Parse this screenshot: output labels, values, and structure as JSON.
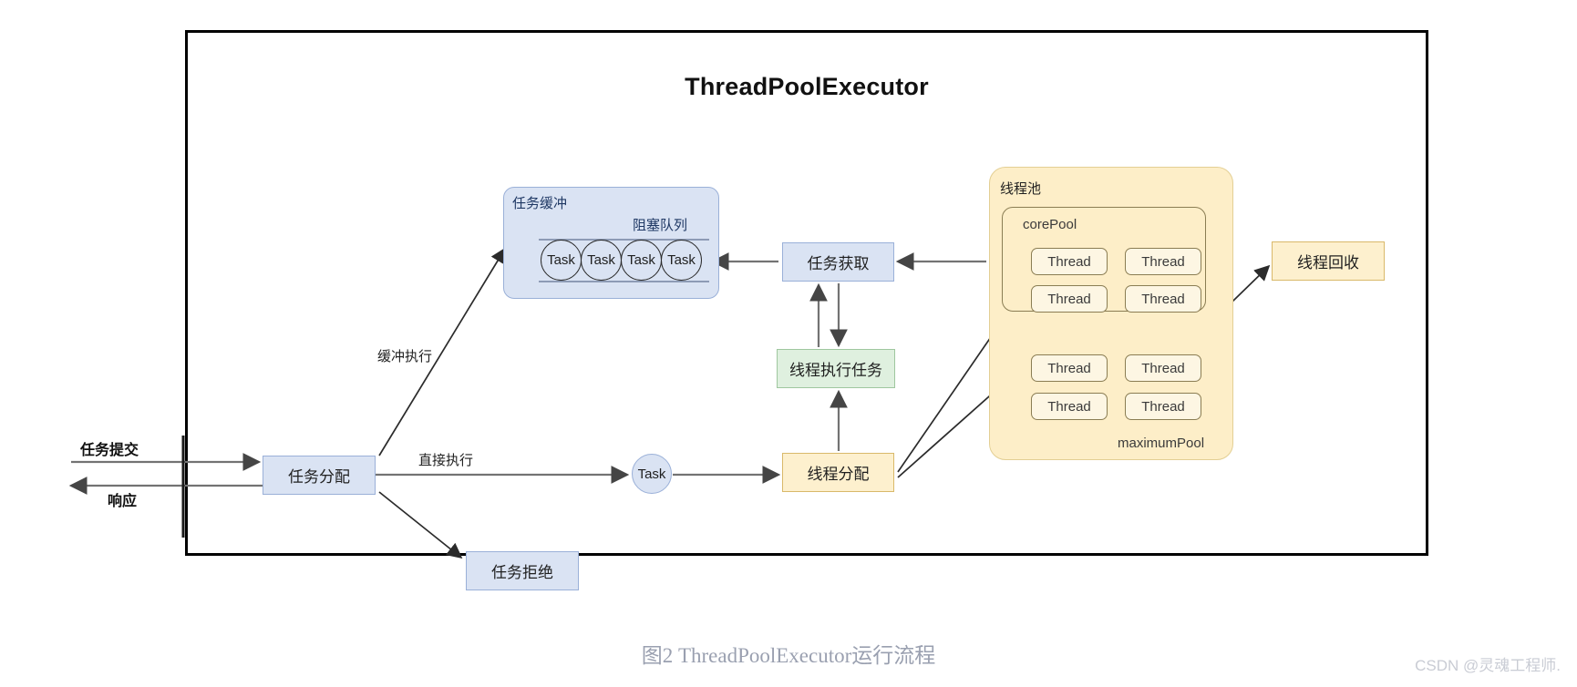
{
  "diagram": {
    "title": "ThreadPoolExecutor",
    "caption": "图2 ThreadPoolExecutor运行流程",
    "watermark": "CSDN @灵魂工程师."
  },
  "colors": {
    "blue_fill": "#dae3f3",
    "blue_stroke": "#9ab0d8",
    "green_fill": "#dff0df",
    "green_stroke": "#9fc79f",
    "orange_fill": "#fdf0ce",
    "orange_stroke": "#d9b96a",
    "pool_fill": "#fdeec8",
    "pool_stroke": "#e3cf94",
    "frame_stroke": "#000000",
    "arrow_stroke": "#737373",
    "thin_arrow_stroke": "#2b2b2b",
    "caption_text": "#9aa0b0",
    "watermark_text": "#c9ccd4"
  },
  "task_buffer": {
    "label": "任务缓冲",
    "queue_label": "阻塞队列",
    "tasks": [
      "Task",
      "Task",
      "Task",
      "Task"
    ]
  },
  "nodes": {
    "task_fetch": "任务获取",
    "thread_exec": "线程执行任务",
    "thread_alloc": "线程分配",
    "task_alloc": "任务分配",
    "task_reject": "任务拒绝",
    "thread_recycle": "线程回收",
    "mid_task": "Task"
  },
  "thread_pool": {
    "label": "线程池",
    "core_pool_label": "corePool",
    "maximum_pool_label": "maximumPool",
    "core_threads": [
      "Thread",
      "Thread",
      "Thread",
      "Thread"
    ],
    "extra_threads": [
      "Thread",
      "Thread",
      "Thread",
      "Thread"
    ]
  },
  "edge_labels": {
    "buffer_exec": "缓冲执行",
    "direct_exec": "直接执行",
    "submit": "任务提交",
    "response": "响应"
  }
}
